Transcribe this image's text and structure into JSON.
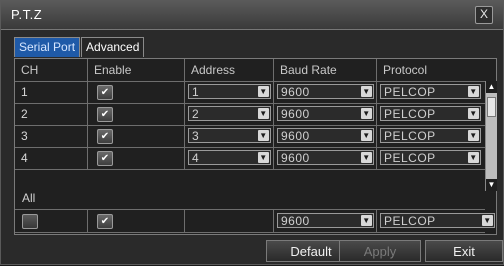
{
  "window": {
    "title": "P.T.Z",
    "close_label": "X"
  },
  "tabs": [
    {
      "label": "Serial Port",
      "active": true
    },
    {
      "label": "Advanced",
      "active": false
    }
  ],
  "table": {
    "headers": [
      "CH",
      "Enable",
      "Address",
      "Baud Rate",
      "Protocol"
    ],
    "rows": [
      {
        "ch": "1",
        "enable": true,
        "address": "1",
        "baud_rate": "9600",
        "protocol": "PELCOP"
      },
      {
        "ch": "2",
        "enable": true,
        "address": "2",
        "baud_rate": "9600",
        "protocol": "PELCOP"
      },
      {
        "ch": "3",
        "enable": true,
        "address": "3",
        "baud_rate": "9600",
        "protocol": "PELCOP"
      },
      {
        "ch": "4",
        "enable": true,
        "address": "4",
        "baud_rate": "9600",
        "protocol": "PELCOP"
      }
    ]
  },
  "all_section": {
    "label": "All",
    "select_all_checked": false,
    "enable": true,
    "baud_rate": "9600",
    "protocol": "PELCOP"
  },
  "buttons": {
    "default": "Default",
    "apply": "Apply",
    "exit": "Exit"
  },
  "colors": {
    "active_tab": "#1f5aa8",
    "background": "#2a2a2a",
    "border": "#7a7a7a"
  }
}
